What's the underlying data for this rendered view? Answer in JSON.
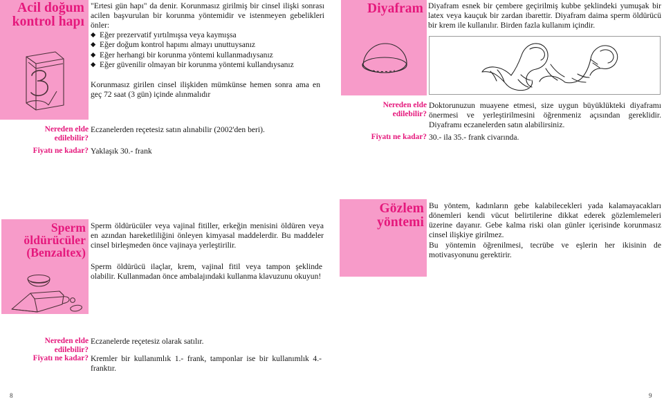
{
  "page": {
    "page_number_left": "8",
    "page_number_right": "9",
    "accent_pink": "#e5187c",
    "panel_pink": "#f79bc9"
  },
  "sections": {
    "emergency_pill": {
      "title": "Acil doğum kontrol hapı",
      "icon": "pill-box-3-icon",
      "intro": "\"Ertesi gün hapı\" da denir. Korunmasız girilmiş bir cinsel ilişki sonrası acilen başvurulan bir korunma yöntemidir ve istenmeyen gebelikleri önler:",
      "bullets": [
        "Eğer prezervatif yırtılmışsa veya kaymışsa",
        "Eğer doğum kontrol hapımı almayı unuttuysanız",
        "Eğer herhangi bir korunma yöntemi kullanmadıysanız",
        "Eğer güvenilir olmayan bir korunma yöntemi kullandıysanız"
      ],
      "bullet_glyph": "◆",
      "note": "Korunmasız girilen cinsel ilişkiden mümkünse hemen sonra ama en geç 72 saat (3 gün) içinde alınmalıdır",
      "where_label": "Nereden elde edilebilir?",
      "where_value": "Eczanelerden reçetesiz satın alınabilir (2002'den beri).",
      "price_label": "Fiyatı ne kadar?",
      "price_value": "Yaklaşık 30.- frank"
    },
    "diaphragm": {
      "title": "Diyafram",
      "icon": "diaphragm-dome-icon",
      "illustration": "diaphragm-insertion-illustration",
      "intro": "Diyafram esnek bir çembere geçirilmiş kubbe şeklindeki yumuşak bir latex veya kauçuk bir zardan ibarettir. Diyafram daima sperm öldürücü bir krem ile kullanılır. Birden fazla kullanım içindir.",
      "where_label": "Nereden elde edilebilir?",
      "where_value": "Doktorunuzun muayene etmesi, size uygun büyüklükteki diyaframı önermesi ve yerleştirilmesini öğrenmeniz açısından gereklidir. Diyaframı eczanelerden satın alabilirsiniz.",
      "price_label": "Fiyatı ne kadar?",
      "price_value": "30.- ila 35.- frank civarında."
    },
    "spermicides": {
      "title": "Sperm öldürücüler (Benzaltex)",
      "icon": "spermicide-tube-icon",
      "paragraph_1": "Sperm öldürücüler veya vajinal fitiller, erkeğin menisini öldüren veya en azından hareketliliğini önleyen kimyasal maddelerdir. Bu maddeler cinsel birleşmeden önce vajinaya yerleştirilir.",
      "paragraph_2": "Sperm öldürücü ilaçlar, krem, vajinal fitil veya tampon şeklinde olabilir. Kullanmadan önce ambalajındaki kullanma klavuzunu okuyun!",
      "where_label": "Nereden elde edilebilir?",
      "where_value": "Eczanelerde reçetesiz olarak satılır.",
      "price_label": "Fiyatı ne kadar?",
      "price_value": "Kremler bir kullanımlık 1.- frank, tamponlar ise bir kullanımlık 4.- franktır."
    },
    "observation_method": {
      "title": "Gözlem yöntemi",
      "paragraph_1": "Bu yöntem, kadınların gebe kalabilecekleri yada kalamayacakları dönemleri kendi vücut belirtilerine dikkat ederek gözlemlemeleri üzerine dayanır. Gebe kalma riski olan günler içerisinde korunmasız cinsel ilişkiye girilmez.",
      "paragraph_2": "Bu yöntemin öğrenilmesi, tecrübe ve eşlerin her ikisinin de motivasyonunu gerektirir."
    }
  }
}
